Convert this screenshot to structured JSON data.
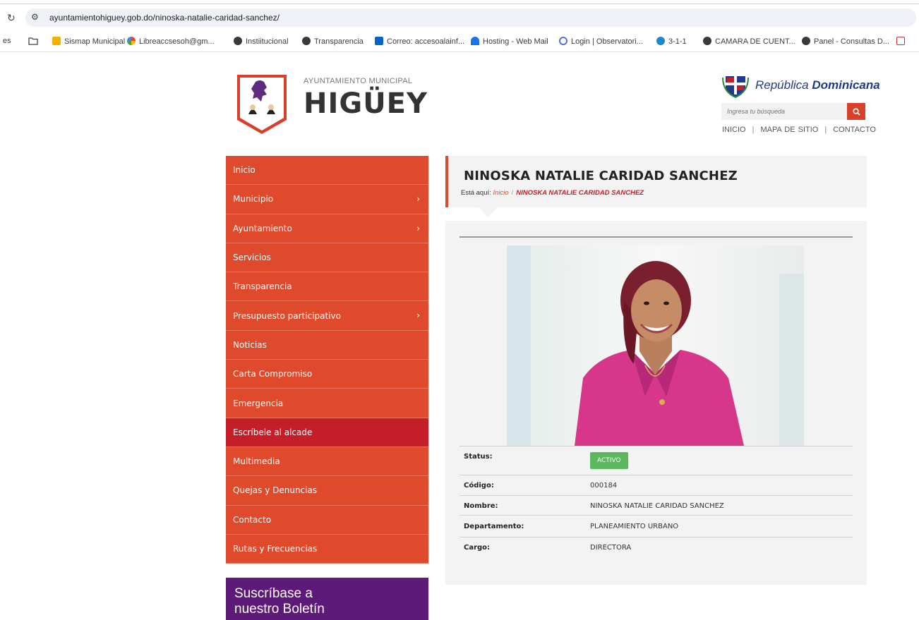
{
  "browser": {
    "url": "ayuntamientohiguey.gob.do/ninoska-natalie-caridad-sanchez/",
    "bookmarks": [
      {
        "label": "Sismap Municipal",
        "icon": "sismap-icon",
        "color": "#f0b400"
      },
      {
        "label": "Libreaccsesoh@gm...",
        "icon": "google-icon",
        "color": "#4285f4"
      },
      {
        "label": "Instiitucional",
        "icon": "globe-icon",
        "color": "#333333"
      },
      {
        "label": "Transparencia",
        "icon": "globe-icon",
        "color": "#333333"
      },
      {
        "label": "Correo: accesoalainf...",
        "icon": "outlook-icon",
        "color": "#0a64c8"
      },
      {
        "label": "Hosting - Web Mail",
        "icon": "hosting-icon",
        "color": "#1a73e8"
      },
      {
        "label": "Login | Observatori...",
        "icon": "search-icon",
        "color": "#5a6fd8"
      },
      {
        "label": "3-1-1",
        "icon": "311-icon",
        "color": "#1e88c8"
      },
      {
        "label": "CAMARA DE CUENT...",
        "icon": "globe-icon",
        "color": "#333333"
      },
      {
        "label": "Panel - Consultas D...",
        "icon": "globe-icon",
        "color": "#333333"
      }
    ]
  },
  "header": {
    "org_top": "AYUNTAMIENTO MUNICIPAL",
    "org_name": "HIGÜEY",
    "rd_prefix": "República",
    "rd_bold": "Dominicana",
    "search_placeholder": "Ingresa tu búsqueda",
    "toplinks": [
      "INICIO",
      "MAPA DE SITIO",
      "CONTACTO"
    ]
  },
  "nav": {
    "items": [
      {
        "label": "Inicio",
        "has_sub": false
      },
      {
        "label": "Municipio",
        "has_sub": true
      },
      {
        "label": "Ayuntamiento",
        "has_sub": true
      },
      {
        "label": "Servicios",
        "has_sub": false
      },
      {
        "label": "Transparencia",
        "has_sub": false
      },
      {
        "label": "Presupuesto participativo",
        "has_sub": true
      },
      {
        "label": "Noticias",
        "has_sub": false
      },
      {
        "label": "Carta Compromiso",
        "has_sub": false
      },
      {
        "label": "Emergencia",
        "has_sub": false
      },
      {
        "label": "Escríbele al alcade",
        "has_sub": false,
        "active": true
      },
      {
        "label": "Multimedia",
        "has_sub": false
      },
      {
        "label": "Quejas y Denuncias",
        "has_sub": false
      },
      {
        "label": "Contacto",
        "has_sub": false
      },
      {
        "label": "Rutas y Frecuencias",
        "has_sub": false
      }
    ],
    "chevron": "›"
  },
  "newsletter": {
    "line1": "Suscríbase a",
    "line2": "nuestro Boletín"
  },
  "main": {
    "title": "NINOSKA NATALIE CARIDAD SANCHEZ",
    "breadcrumb": {
      "prefix": "Está aquí:",
      "home": "Inicio",
      "separator": "/",
      "current": "NINOSKA NATALIE CARIDAD SANCHEZ"
    },
    "fields": {
      "status_label": "Status:",
      "status_value": "ACTIVO",
      "codigo_label": "Código:",
      "codigo_value": "000184",
      "nombre_label": "Nombre:",
      "nombre_value": "NINOSKA NATALIE CARIDAD SANCHEZ",
      "departamento_label": "Departamento:",
      "departamento_value": "PLANEAMIENTO URBANO",
      "cargo_label": "Cargo:",
      "cargo_value": "DIRECTORA"
    }
  },
  "colors": {
    "nav_red": "#df4a2c",
    "nav_active": "#c41e28",
    "newsletter_purple": "#5e1a78",
    "status_green": "#5cb85c",
    "rd_blue": "#1f3a8c"
  }
}
